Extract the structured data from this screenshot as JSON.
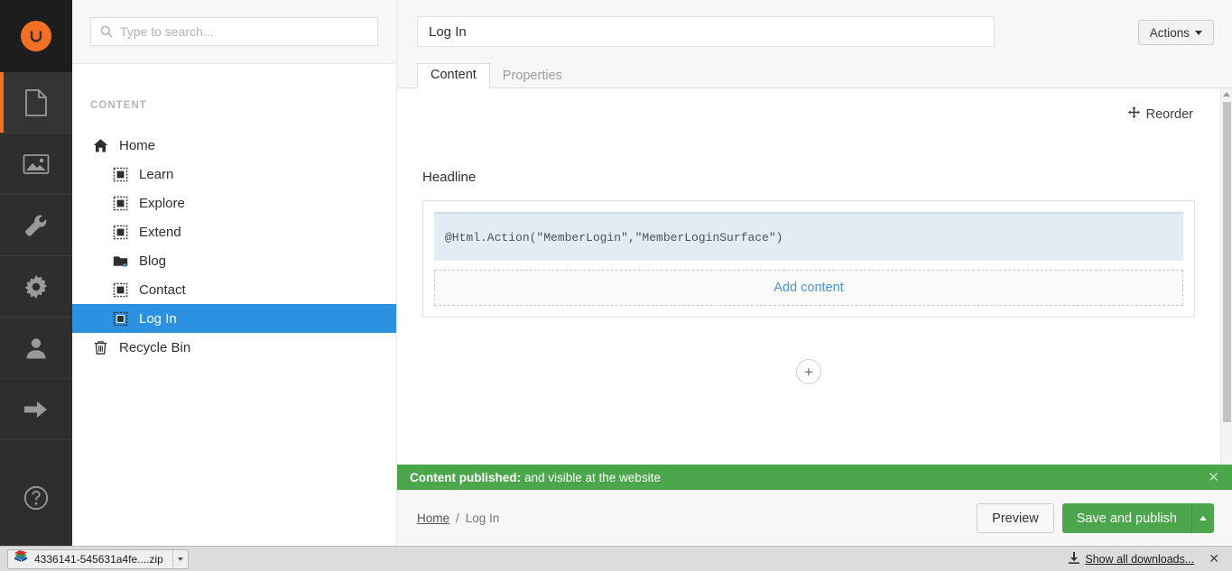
{
  "app": {
    "name": "Umbraco",
    "logo_icon": "umbraco-logo-icon",
    "accent_orange": "#f36f21",
    "selection_blue": "#2b91e0",
    "success_green": "#4ca64c"
  },
  "rail": {
    "items": [
      {
        "key": "content",
        "icon": "document-icon",
        "active": true
      },
      {
        "key": "media",
        "icon": "image-icon",
        "active": false
      },
      {
        "key": "settings",
        "icon": "wrench-icon",
        "active": false
      },
      {
        "key": "developer",
        "icon": "gear-icon",
        "active": false
      },
      {
        "key": "users",
        "icon": "user-icon",
        "active": false
      },
      {
        "key": "forms",
        "icon": "arrow-right-icon",
        "active": false
      },
      {
        "key": "help",
        "icon": "question-circle-icon",
        "active": false
      }
    ]
  },
  "search": {
    "placeholder": "Type to search...",
    "value": "",
    "icon": "search-icon"
  },
  "tree": {
    "section_title": "CONTENT",
    "nodes": [
      {
        "label": "Home",
        "icon": "home-icon",
        "level": 0,
        "selected": false
      },
      {
        "label": "Learn",
        "icon": "document-icon",
        "level": 1,
        "selected": false
      },
      {
        "label": "Explore",
        "icon": "document-icon",
        "level": 1,
        "selected": false
      },
      {
        "label": "Extend",
        "icon": "document-icon",
        "level": 1,
        "selected": false
      },
      {
        "label": "Blog",
        "icon": "folder-icon",
        "level": 1,
        "selected": false
      },
      {
        "label": "Contact",
        "icon": "document-icon",
        "level": 1,
        "selected": false
      },
      {
        "label": "Log In",
        "icon": "document-icon",
        "level": 1,
        "selected": true
      },
      {
        "label": "Recycle Bin",
        "icon": "trash-icon",
        "level": 0,
        "selected": false
      }
    ]
  },
  "editor": {
    "title_value": "Log In",
    "title_placeholder": "Enter a name...",
    "actions_label": "Actions",
    "tabs": [
      {
        "label": "Content",
        "active": true
      },
      {
        "label": "Properties",
        "active": false
      }
    ],
    "reorder_label": "Reorder",
    "reorder_icon": "move-icon",
    "property_label": "Headline",
    "grid_cell_code": "@Html.Action(\"MemberLogin\",\"MemberLoginSurface\")",
    "add_content_label": "Add content",
    "add_row_label": "+"
  },
  "notification": {
    "headline": "Content published:",
    "message": "and visible at the website",
    "close_icon": "close-icon"
  },
  "footer": {
    "breadcrumb": [
      {
        "label": "Home",
        "link": true
      },
      {
        "label": "/",
        "link": false
      },
      {
        "label": "Log In",
        "link": false
      }
    ],
    "preview_label": "Preview",
    "publish_label": "Save and publish"
  },
  "browser_downloads": {
    "file_name": "4336141-545631a4fe....zip",
    "file_icon": "archive-icon",
    "show_all_label": "Show all downloads...",
    "show_all_icon": "download-icon",
    "close_icon": "close-icon"
  }
}
